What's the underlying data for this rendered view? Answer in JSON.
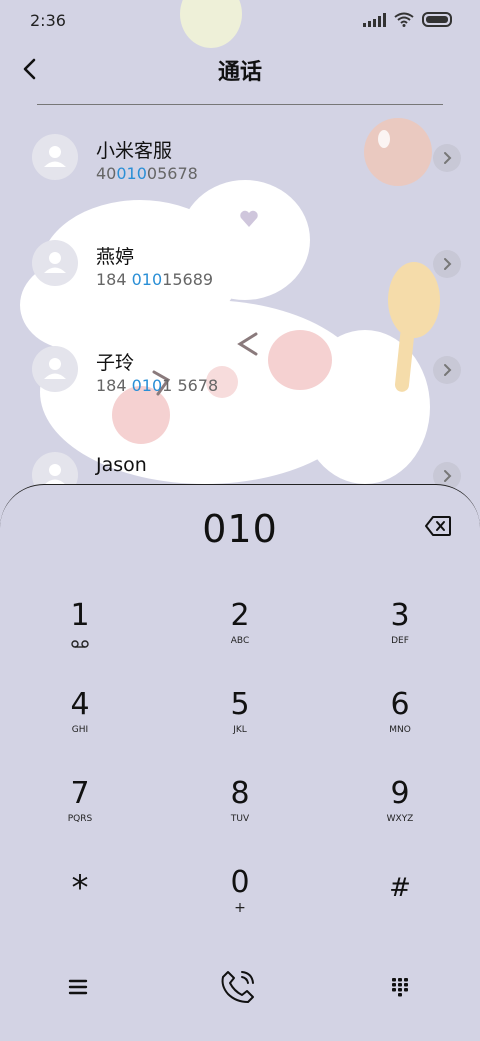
{
  "status_bar": {
    "time": "2:36"
  },
  "header": {
    "title": "通话"
  },
  "contacts": [
    {
      "name": "小米客服",
      "number_parts": [
        "40",
        "010",
        "05678"
      ]
    },
    {
      "name": "燕婷",
      "number_parts": [
        "184 ",
        "010",
        "15689"
      ]
    },
    {
      "name": "子玲",
      "number_parts": [
        "184 ",
        "010",
        "1 5678"
      ]
    },
    {
      "name": "Jason",
      "number_parts": [
        "",
        "",
        ""
      ]
    }
  ],
  "dialer": {
    "input": "010",
    "keys": [
      {
        "digit": "1",
        "letters": ""
      },
      {
        "digit": "2",
        "letters": "ABC"
      },
      {
        "digit": "3",
        "letters": "DEF"
      },
      {
        "digit": "4",
        "letters": "GHI"
      },
      {
        "digit": "5",
        "letters": "JKL"
      },
      {
        "digit": "6",
        "letters": "MNO"
      },
      {
        "digit": "7",
        "letters": "PQRS"
      },
      {
        "digit": "8",
        "letters": "TUV"
      },
      {
        "digit": "9",
        "letters": "WXYZ"
      },
      {
        "digit": "*",
        "letters": ""
      },
      {
        "digit": "0",
        "letters": "+"
      },
      {
        "digit": "#",
        "letters": ""
      }
    ]
  },
  "icons": {
    "back": "back-arrow-icon",
    "chevron": "chevron-right-icon",
    "voicemail": "voicemail-icon",
    "backspace": "backspace-icon",
    "menu": "menu-icon",
    "call": "phone-icon",
    "keypad": "keypad-icon"
  },
  "colors": {
    "highlight": "#2a8fd6",
    "background": "#d3d3e4"
  }
}
